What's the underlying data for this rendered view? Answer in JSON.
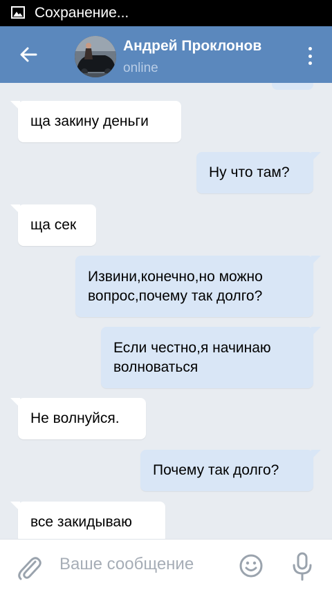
{
  "statusbar": {
    "text": "Сохранение...",
    "icon": "gallery-icon"
  },
  "header": {
    "back_icon": "back-arrow-icon",
    "contact_name": "Андрей Проклонов",
    "contact_status": "online",
    "menu_icon": "more-vertical-icon"
  },
  "messages": [
    {
      "direction": "in",
      "text": "ща закину деньги"
    },
    {
      "direction": "out",
      "text": "Ну что там?"
    },
    {
      "direction": "in",
      "text": "ща сек"
    },
    {
      "direction": "out",
      "text": "Извини,конечно,но можно\nвопрос,почему так долго?"
    },
    {
      "direction": "out",
      "text": "Если честно,я начинаю\nволноваться"
    },
    {
      "direction": "in",
      "text": "Не волнуйся."
    },
    {
      "direction": "out",
      "text": "Почему так долго?"
    },
    {
      "direction": "in",
      "text": "все закидываю"
    }
  ],
  "composer": {
    "placeholder": "Ваше сообщение",
    "attach_icon": "paperclip-icon",
    "emoji_icon": "smiley-icon",
    "mic_icon": "microphone-icon"
  },
  "colors": {
    "header": "#5b88bd",
    "chat_background": "#e8ecf1",
    "incoming_bubble": "#ffffff",
    "outgoing_bubble": "#d9e6f6",
    "icon_gray": "#9aa3ad"
  }
}
